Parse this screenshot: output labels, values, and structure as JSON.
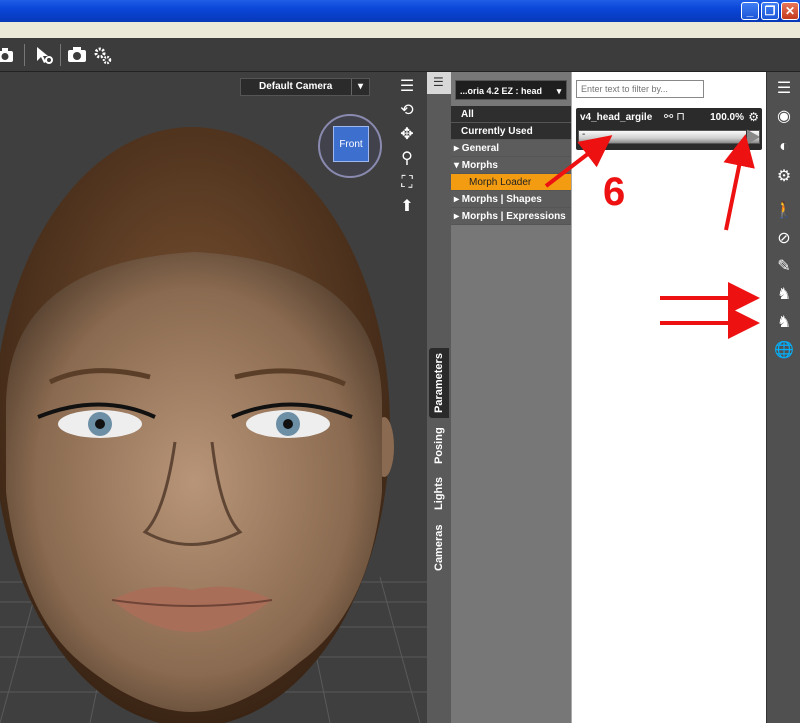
{
  "window": {
    "controls": [
      "_",
      "❐",
      "✕"
    ]
  },
  "toolbar": {
    "icons": [
      "camera-icon",
      "render-settings-icon",
      "render-icon",
      "gear-icon"
    ]
  },
  "viewport": {
    "camera_label": "Default Camera",
    "camera_dropdown": "▾",
    "cube_label": "Front",
    "tool_icons": [
      "list-icon",
      "orbit-icon",
      "move-icon",
      "zoom-icon",
      "frame-icon",
      "reset-icon"
    ]
  },
  "side_tabs": {
    "parameters": "Parameters",
    "posing": "Posing",
    "lights": "Lights",
    "cameras": "Cameras"
  },
  "node_selector": {
    "label": "...oria 4.2 EZ : head",
    "dropdown": "▾"
  },
  "categories": [
    {
      "label": "All",
      "kind": "item"
    },
    {
      "label": "Currently Used",
      "kind": "item"
    },
    {
      "label": "▸ General",
      "kind": "group"
    },
    {
      "label": "▾ Morphs",
      "kind": "group"
    },
    {
      "label": "Morph Loader",
      "kind": "selected"
    },
    {
      "label": "▸ Morphs | Shapes",
      "kind": "group"
    },
    {
      "label": "▸ Morphs | Expressions",
      "kind": "group"
    }
  ],
  "filter": {
    "placeholder": "Enter text to filter by..."
  },
  "slider": {
    "name": "v4_head_argile",
    "value": "100.0%",
    "fraction": 1.0,
    "min_marker": "-"
  },
  "annotation": {
    "step": "6"
  },
  "colors": {
    "accent_orange": "#f39c12",
    "annotation_red": "#ee1111",
    "title_blue": "#0a46d8"
  }
}
